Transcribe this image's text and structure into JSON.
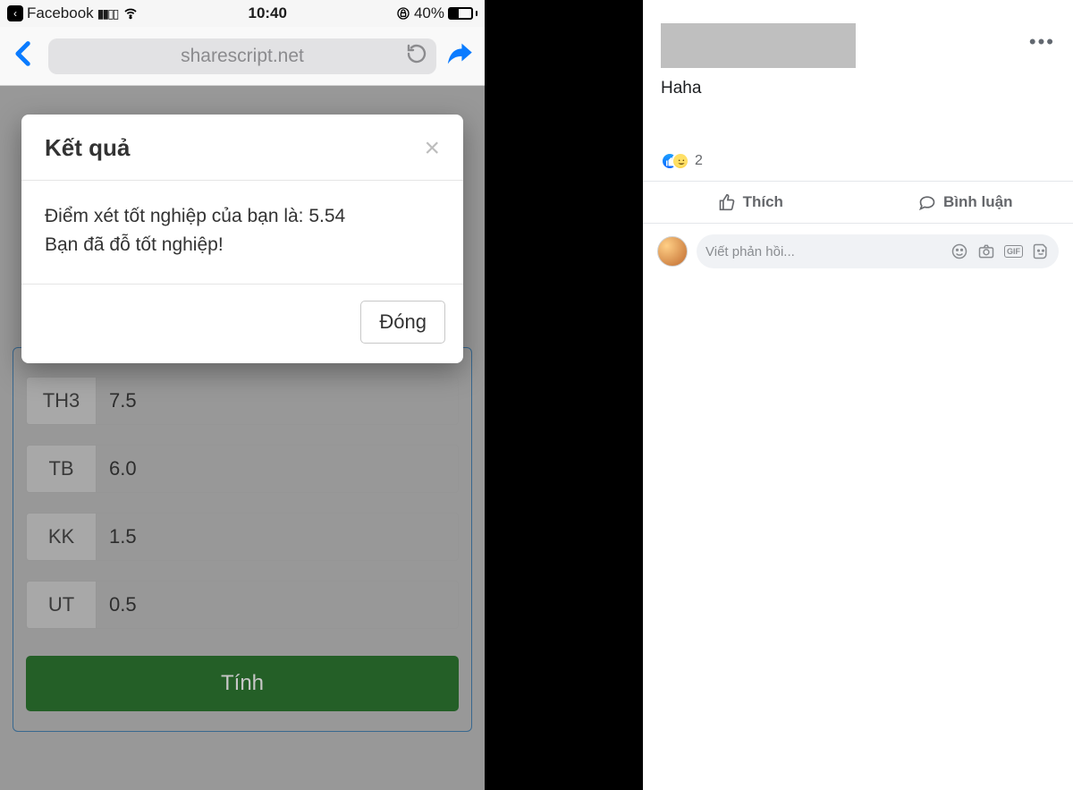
{
  "status": {
    "app": "Facebook",
    "time": "10:40",
    "battery": "40%"
  },
  "nav": {
    "url": "sharescript.net"
  },
  "modal": {
    "title": "Kết quả",
    "line1": "Điểm xét tốt nghiệp của bạn là: 5.54",
    "line2": "Bạn đã đỗ tốt nghiệp!",
    "close": "Đóng"
  },
  "rows": {
    "th3": {
      "label": "TH3",
      "value": "7.5"
    },
    "tb": {
      "label": "TB",
      "value": "6.0"
    },
    "kk": {
      "label": "KK",
      "value": "1.5"
    },
    "ut": {
      "label": "UT",
      "value": "0.5"
    }
  },
  "calc": "Tính",
  "fb": {
    "text": "Haha",
    "react_count": "2",
    "like": "Thích",
    "comment": "Bình luận",
    "placeholder": "Viết phản hồi...",
    "gif": "GIF"
  }
}
